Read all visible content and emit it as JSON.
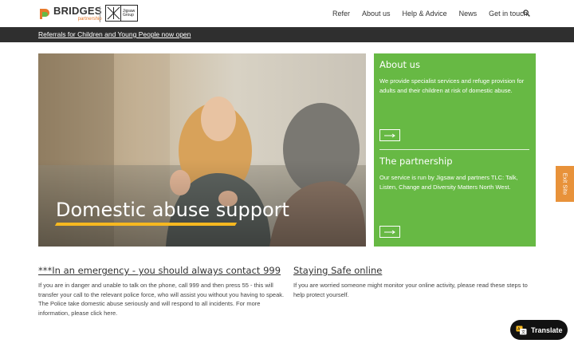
{
  "brand": {
    "name": "BRIDGES",
    "subtitle": "partnership",
    "partner_logo_text": "Jigsaw Group",
    "accent": "#e8792b",
    "green": "#67b944"
  },
  "nav": {
    "items": [
      "Refer",
      "About us",
      "Help & Advice",
      "News",
      "Get in touch"
    ],
    "search_icon": "search-icon"
  },
  "banner": {
    "link": "Referrals for Children and Young People now open"
  },
  "hero": {
    "title": "Domestic abuse support",
    "underline_color": "#f6b820"
  },
  "panel": {
    "about_heading": "About us",
    "about_text": "We provide specialist services and refuge provision for adults and their children at risk of domestic abuse.",
    "partnership_heading": "The partnership",
    "partnership_text": "Our service is run by Jigsaw and partners TLC: Talk, Listen, Change and Diversity Matters North West."
  },
  "exit": {
    "label": "Exit Site",
    "color": "#e8923a"
  },
  "emergency": {
    "heading": "***In an emergency - you should always contact 999",
    "text": "If you are in danger and unable to talk on the phone, call 999 and then press 55 - this will transfer your call to the relevant police force, who will assist you without you having to speak. The Police take domestic abuse seriously and will respond to all incidents. For more information, please click here."
  },
  "safe_online": {
    "heading": "Staying Safe online",
    "text": "If you are worried someone might monitor your online activity, please read these steps to help protect yourself."
  },
  "translate": {
    "label": "Translate"
  }
}
